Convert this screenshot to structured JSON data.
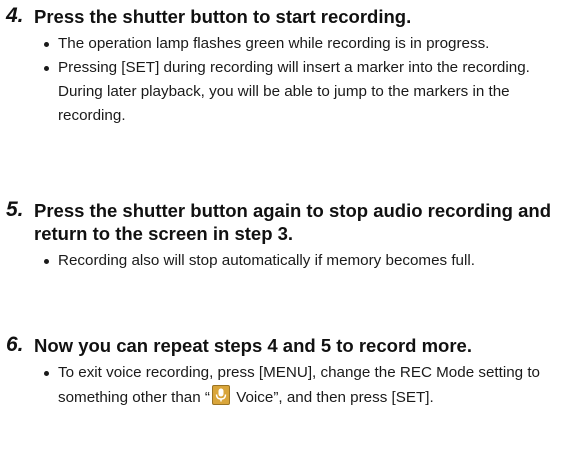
{
  "steps": [
    {
      "number": "4.",
      "title": "Press the shutter button to start recording.",
      "bullets": [
        "The operation lamp flashes green while recording is in progress.",
        "Pressing [SET] during recording will insert a marker into the recording. During later playback, you will be able to jump to the markers in the recording."
      ]
    },
    {
      "number": "5.",
      "title": "Press the shutter button again to stop audio recording and return to the screen in step 3.",
      "bullets": [
        "Recording also will stop automatically if memory becomes full."
      ]
    },
    {
      "number": "6.",
      "title": "Now you can repeat steps 4 and 5 to record more.",
      "bullets": [
        {
          "before": "To exit voice recording, press [MENU], change the REC Mode setting to something other than “",
          "icon": "microphone-icon",
          "after": " Voice”, and then press [SET]."
        }
      ]
    }
  ],
  "colors": {
    "text": "#1a1a1a",
    "mic_badge": "#d9a53a"
  }
}
